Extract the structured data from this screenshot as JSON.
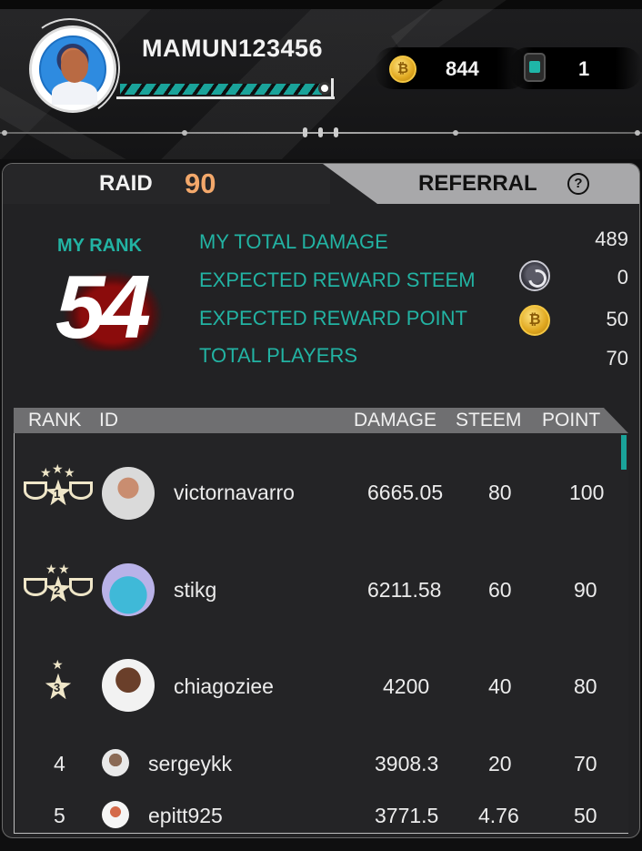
{
  "profile": {
    "username": "MAMUN123456",
    "avatar_text": "mamun123456",
    "coins": "844",
    "items": "1"
  },
  "tabs": {
    "raid_label": "RAID",
    "raid_value": "90",
    "referral_label": "REFERRAL",
    "help_icon": "?"
  },
  "summary": {
    "my_rank_label": "MY RANK",
    "my_rank": "54",
    "rows": [
      {
        "label": "MY TOTAL DAMAGE",
        "value": "489"
      },
      {
        "label": "EXPECTED REWARD STEEM",
        "value": "0"
      },
      {
        "label": "EXPECTED REWARD POINT",
        "value": "50"
      },
      {
        "label": "TOTAL PLAYERS",
        "value": "70"
      }
    ]
  },
  "table": {
    "headers": {
      "rank": "RANK",
      "id": "ID",
      "damage": "DAMAGE",
      "steem": "STEEM",
      "point": "POINT"
    },
    "rows": [
      {
        "rank": "1",
        "id": "victornavarro",
        "damage": "6665.05",
        "steem": "80",
        "point": "100"
      },
      {
        "rank": "2",
        "id": "stikg",
        "damage": "6211.58",
        "steem": "60",
        "point": "90"
      },
      {
        "rank": "3",
        "id": "chiagoziee",
        "damage": "4200",
        "steem": "40",
        "point": "80"
      },
      {
        "rank": "4",
        "id": "sergeykk",
        "damage": "3908.3",
        "steem": "20",
        "point": "70"
      },
      {
        "rank": "5",
        "id": "epitt925",
        "damage": "3771.5",
        "steem": "4.76",
        "point": "50"
      }
    ]
  },
  "colors": {
    "accent_teal": "#22b3a3",
    "raid_value": "#f3a86b",
    "background": "#222224"
  },
  "icons": [
    "avatar",
    "coin-icon",
    "gadget-icon",
    "help-icon",
    "steem-icon",
    "point-coin-icon",
    "rank-badge-icon"
  ]
}
